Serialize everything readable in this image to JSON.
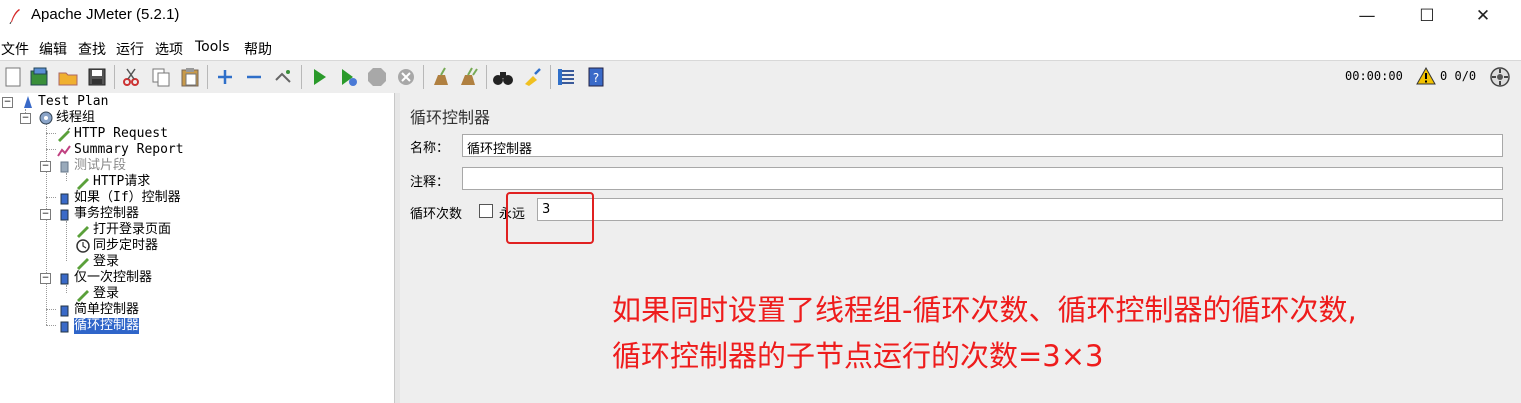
{
  "window": {
    "title": "Apache JMeter (5.2.1)",
    "minimize": "—",
    "maximize": "☐",
    "close": "✕"
  },
  "menu": [
    "文件",
    "编辑",
    "查找",
    "运行",
    "选项",
    "Tools",
    "帮助"
  ],
  "toolbar": {
    "icons": [
      "new-icon",
      "templates-icon",
      "open-icon",
      "save-icon",
      "cut-icon",
      "copy-icon",
      "paste-icon",
      "expand-icon",
      "collapse-icon",
      "toggle-icon",
      "start-icon",
      "start-no-pauses-icon",
      "stop-icon",
      "shutdown-icon",
      "clear-icon",
      "clear-all-icon",
      "search-icon",
      "reset-search-icon",
      "function-helper-icon",
      "help-icon"
    ],
    "timer": "00:00:00",
    "warnings": "0",
    "threads": "0/0"
  },
  "tree": [
    {
      "label": "Test Plan",
      "name": "tree-node-test-plan"
    },
    {
      "label": "线程组",
      "name": "tree-node-thread-group"
    },
    {
      "label": "HTTP Request",
      "name": "tree-node-http-request"
    },
    {
      "label": "Summary Report",
      "name": "tree-node-summary-report"
    },
    {
      "label": "测试片段",
      "name": "tree-node-test-fragment"
    },
    {
      "label": "HTTP请求",
      "name": "tree-node-http-request-cn"
    },
    {
      "label": "如果（If）控制器",
      "name": "tree-node-if-controller"
    },
    {
      "label": "事务控制器",
      "name": "tree-node-transaction-controller"
    },
    {
      "label": "打开登录页面",
      "name": "tree-node-open-login-page"
    },
    {
      "label": "同步定时器",
      "name": "tree-node-sync-timer"
    },
    {
      "label": "登录",
      "name": "tree-node-login-1"
    },
    {
      "label": "仅一次控制器",
      "name": "tree-node-once-only-controller"
    },
    {
      "label": "登录",
      "name": "tree-node-login-2"
    },
    {
      "label": "简单控制器",
      "name": "tree-node-simple-controller"
    },
    {
      "label": "循环控制器",
      "name": "tree-node-loop-controller"
    }
  ],
  "panel": {
    "title": "循环控制器",
    "name_label": "名称：",
    "name_value": "循环控制器",
    "comment_label": "注释：",
    "comment_value": "",
    "loop_label": "循环次数",
    "forever_label": "永远",
    "loop_value": "3"
  },
  "annotation": {
    "line1": "如果同时设置了线程组-循环次数、循环控制器的循环次数,",
    "line2": "循环控制器的子节点运行的次数=3×3",
    "color": "#ee1c1c"
  }
}
